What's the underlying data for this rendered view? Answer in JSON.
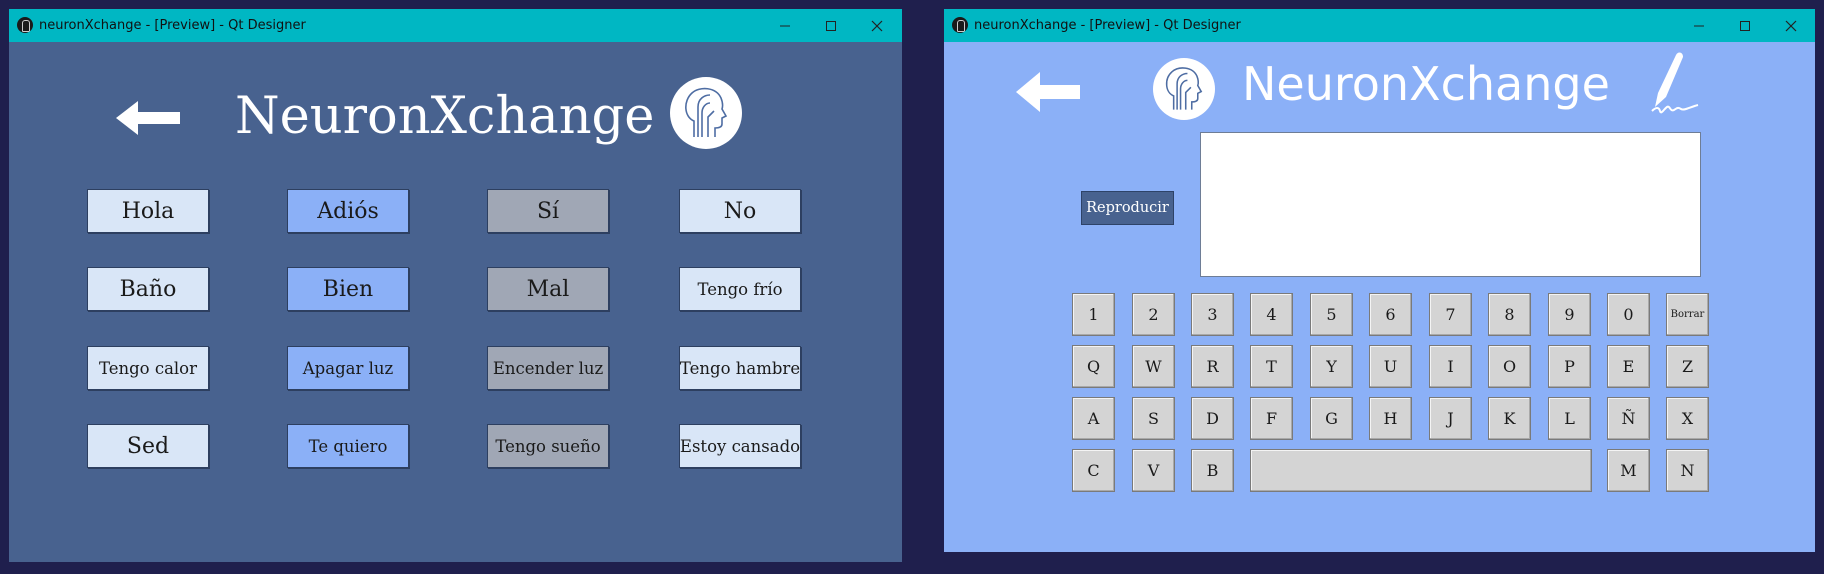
{
  "window1": {
    "titlebar_text": "neuronXchange - [Preview] - Qt Designer",
    "app_title": "NeuronXchange",
    "icons": {
      "back": "left-arrow-icon",
      "logo": "head-circuit-logo-icon"
    },
    "colors": {
      "background": "#48628f",
      "button_light": "#d9e6f7",
      "button_blue": "#8bb0f7",
      "button_gray": "#a0a7b5"
    },
    "buttons": [
      {
        "label": "Hola"
      },
      {
        "label": "Adiós"
      },
      {
        "label": "Sí"
      },
      {
        "label": "No"
      },
      {
        "label": "Baño"
      },
      {
        "label": "Bien"
      },
      {
        "label": "Mal"
      },
      {
        "label": "Tengo frío"
      },
      {
        "label": "Tengo calor"
      },
      {
        "label": "Apagar luz"
      },
      {
        "label": "Encender luz"
      },
      {
        "label": "Tengo hambre"
      },
      {
        "label": "Sed"
      },
      {
        "label": "Te quiero"
      },
      {
        "label": "Tengo sueño"
      },
      {
        "label": "Estoy cansado"
      }
    ]
  },
  "window2": {
    "titlebar_text": "neuronXchange - [Preview] - Qt Designer",
    "app_title": "NeuronXchange",
    "icons": {
      "back": "left-arrow-icon",
      "logo": "head-circuit-logo-icon",
      "write": "quill-signature-icon"
    },
    "colors": {
      "background": "#8bb0f7",
      "key": "#d4d4d4"
    },
    "reproducir_label": "Reproducir",
    "text_value": "",
    "keys": {
      "row1": [
        "1",
        "2",
        "3",
        "4",
        "5",
        "6",
        "7",
        "8",
        "9",
        "0",
        "Borrar"
      ],
      "row2": [
        "Q",
        "W",
        "R",
        "T",
        "Y",
        "U",
        "I",
        "O",
        "P",
        "E",
        "Z"
      ],
      "row3": [
        "A",
        "S",
        "D",
        "F",
        "G",
        "H",
        "J",
        "K",
        "L",
        "Ñ",
        "X"
      ],
      "row4": [
        "C",
        "V",
        "B",
        "",
        "M",
        "N"
      ]
    }
  }
}
